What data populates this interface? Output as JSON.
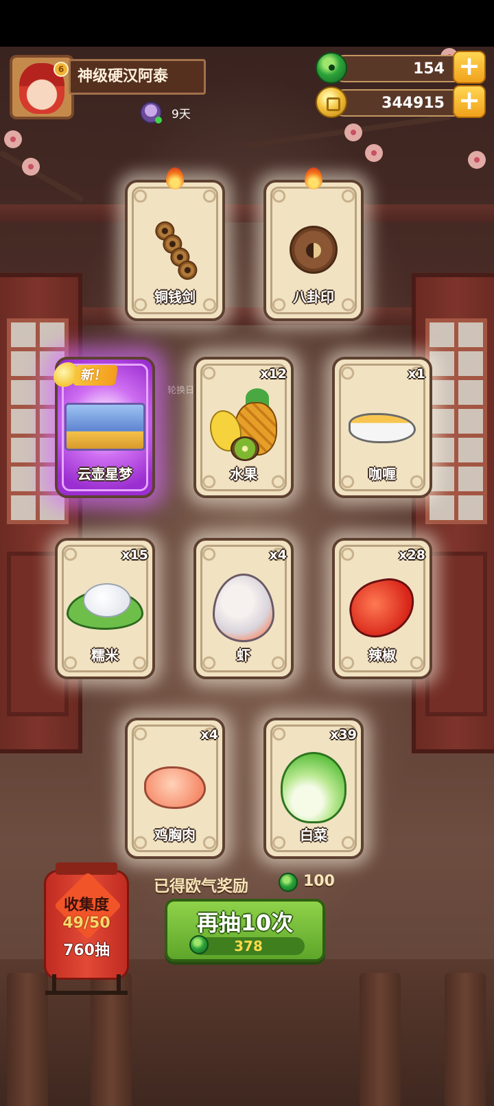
{
  "player": {
    "name": "神级硬汉阿泰",
    "avatar_badge": "6",
    "days": "9天"
  },
  "currency": {
    "jade": "154",
    "gold": "344915"
  },
  "background_caption": "轮换日历",
  "cards": [
    {
      "label": "铜钱剑",
      "count": "",
      "icon": "copper-coin-sword-icon",
      "flame": true
    },
    {
      "label": "八卦印",
      "count": "",
      "icon": "bagua-seal-icon",
      "flame": true
    },
    {
      "label": "云壶星梦",
      "count": "",
      "icon": "scene-illustration",
      "new": true,
      "new_label": "新！"
    },
    {
      "label": "水果",
      "count": "x12",
      "icon": "fruit-icon"
    },
    {
      "label": "咖喱",
      "count": "x1",
      "icon": "curry-icon"
    },
    {
      "label": "糯米",
      "count": "x15",
      "icon": "sticky-rice-icon"
    },
    {
      "label": "虾",
      "count": "x4",
      "icon": "shrimp-icon"
    },
    {
      "label": "辣椒",
      "count": "x28",
      "icon": "chili-icon"
    },
    {
      "label": "鸡胸肉",
      "count": "x4",
      "icon": "chicken-breast-icon"
    },
    {
      "label": "白菜",
      "count": "x39",
      "icon": "cabbage-icon"
    }
  ],
  "reward": {
    "label": "已得欧气奖励",
    "value": "100"
  },
  "collection": {
    "title": "收集度",
    "progress": "49/50",
    "draws": "760抽"
  },
  "draw_button": {
    "label": "再抽10次",
    "cost": "378"
  },
  "colors": {
    "draw_button": "#6cb432",
    "special_card": "#b848e6",
    "plus_button": "#f6b52a"
  }
}
